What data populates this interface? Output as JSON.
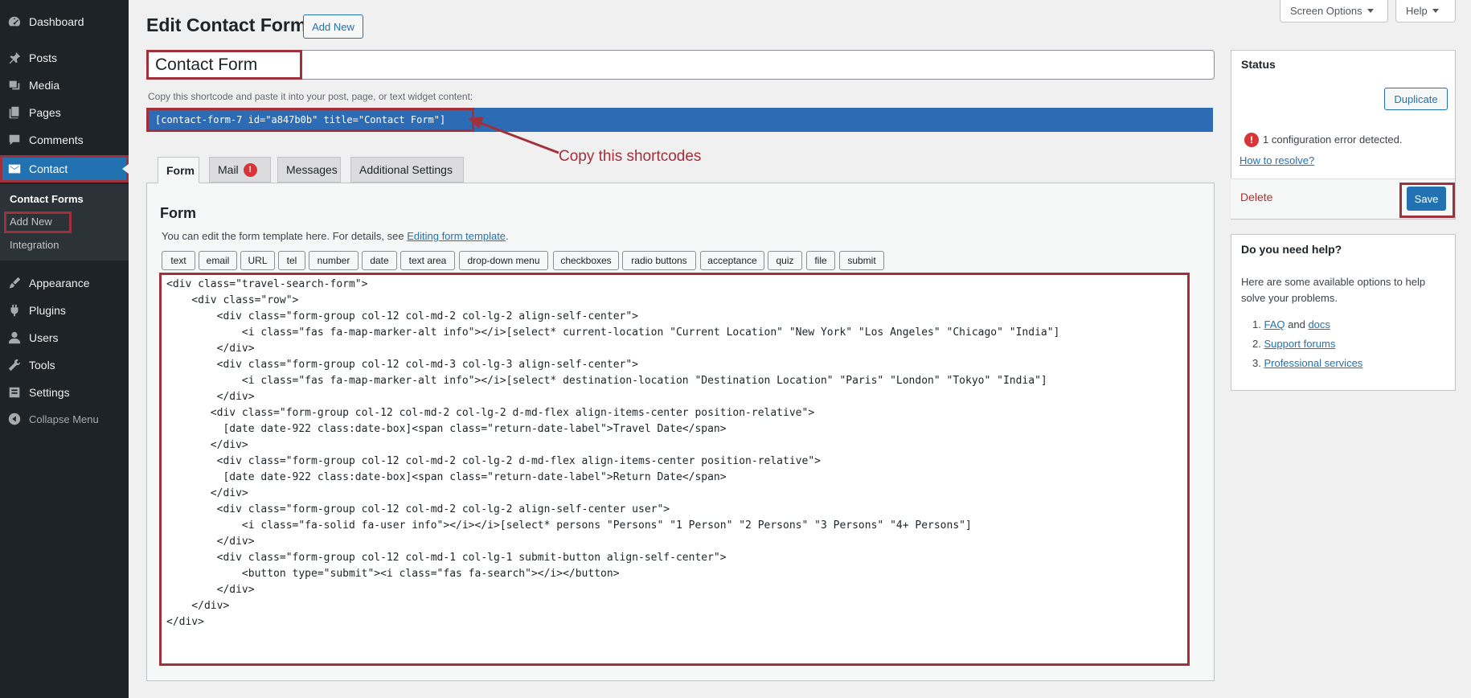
{
  "sidebar": {
    "items": [
      {
        "label": "Dashboard",
        "icon": "dashboard-icon"
      },
      {
        "label": "Posts",
        "icon": "pin-icon"
      },
      {
        "label": "Media",
        "icon": "media-icon"
      },
      {
        "label": "Pages",
        "icon": "pages-icon"
      },
      {
        "label": "Comments",
        "icon": "comments-icon"
      },
      {
        "label": "Contact",
        "icon": "envelope-icon"
      },
      {
        "label": "Appearance",
        "icon": "brush-icon"
      },
      {
        "label": "Plugins",
        "icon": "plugin-icon"
      },
      {
        "label": "Users",
        "icon": "user-icon"
      },
      {
        "label": "Tools",
        "icon": "wrench-icon"
      },
      {
        "label": "Settings",
        "icon": "settings-icon"
      }
    ],
    "submenu": [
      "Contact Forms",
      "Add New",
      "Integration"
    ],
    "collapse_label": "Collapse Menu"
  },
  "top": {
    "screen_options": "Screen Options",
    "help": "Help"
  },
  "header": {
    "title": "Edit Contact Form",
    "add_new": "Add New"
  },
  "form_title": "Contact Form",
  "shortcode": {
    "description": "Copy this shortcode and paste it into your post, page, or text widget content:",
    "value": "[contact-form-7 id=\"a847b0b\" title=\"Contact Form\"]",
    "annotation": "Copy this shortcodes"
  },
  "tabs": [
    "Form",
    "Mail",
    "Messages",
    "Additional Settings"
  ],
  "mail_badge": "!",
  "panel": {
    "heading": "Form",
    "desc": "You can edit the form template here. For details, see",
    "link": "Editing form template",
    "desc_end": "."
  },
  "tag_buttons": [
    "text",
    "email",
    "URL",
    "tel",
    "number",
    "date",
    "text area",
    "drop-down menu",
    "checkboxes",
    "radio buttons",
    "acceptance",
    "quiz",
    "file",
    "submit"
  ],
  "code_lines": [
    "<div class=\"travel-search-form\">",
    "    <div class=\"row\">",
    "        <div class=\"form-group col-12 col-md-2 col-lg-2 align-self-center\">",
    "            <i class=\"fas fa-map-marker-alt info\"></i>[select* current-location \"Current Location\" \"New York\" \"Los Angeles\" \"Chicago\" \"India\"]",
    "        </div>",
    "        <div class=\"form-group col-12 col-md-3 col-lg-3 align-self-center\">",
    "            <i class=\"fas fa-map-marker-alt info\"></i>[select* destination-location \"Destination Location\" \"Paris\" \"London\" \"Tokyo\" \"India\"]",
    "        </div>",
    "       <div class=\"form-group col-12 col-md-2 col-lg-2 d-md-flex align-items-center position-relative\">",
    "         [date date-922 class:date-box]<span class=\"return-date-label\">Travel Date</span>",
    "       </div>",
    "        <div class=\"form-group col-12 col-md-2 col-lg-2 d-md-flex align-items-center position-relative\">",
    "         [date date-922 class:date-box]<span class=\"return-date-label\">Return Date</span>",
    "       </div>",
    "        <div class=\"form-group col-12 col-md-2 col-lg-2 align-self-center user\">",
    "            <i class=\"fa-solid fa-user info\"></i></i>[select* persons \"Persons\" \"1 Person\" \"2 Persons\" \"3 Persons\" \"4+ Persons\"]",
    "        </div>",
    "        <div class=\"form-group col-12 col-md-1 col-lg-1 submit-button align-self-center\">",
    "            <button type=\"submit\"><i class=\"fas fa-search\"></i></button>",
    "        </div>",
    "    </div>",
    "</div>"
  ],
  "status": {
    "title": "Status",
    "duplicate": "Duplicate",
    "error_icon": "!",
    "error_text": "1 configuration error detected.",
    "resolve": "How to resolve?",
    "delete": "Delete",
    "save": "Save"
  },
  "help": {
    "title": "Do you need help?",
    "desc": "Here are some available options to help solve your problems.",
    "item1_num": "1.",
    "faq": "FAQ",
    "and": "and",
    "docs": "docs",
    "item2_num": "2.",
    "support": "Support forums",
    "item3_num": "3.",
    "services": "Professional services"
  }
}
